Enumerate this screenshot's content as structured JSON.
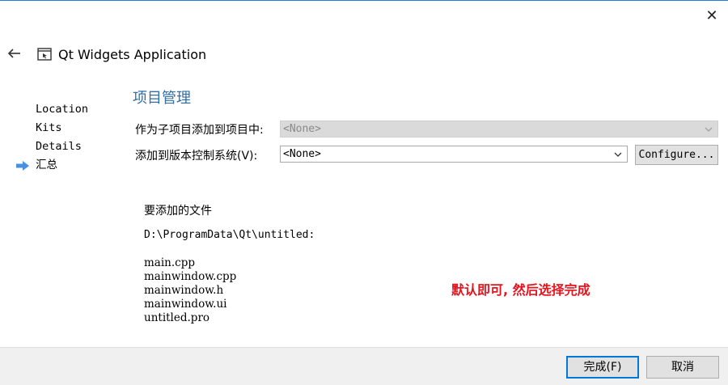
{
  "window": {
    "close_label": "✕",
    "title": "Qt Widgets Application",
    "back_icon": "back-arrow-icon",
    "app_icon": "qt-widgets-app-icon"
  },
  "nav": {
    "items": [
      {
        "label": "Location",
        "active": false
      },
      {
        "label": "Kits",
        "active": false
      },
      {
        "label": "Details",
        "active": false
      },
      {
        "label": "汇总",
        "active": true
      }
    ],
    "active_arrow_color": "#4a8fe0"
  },
  "page": {
    "heading": "项目管理",
    "subproject": {
      "label": "作为子项目添加到项目中:",
      "value": "<None>"
    },
    "vcs": {
      "label": "添加到版本控制系统(V):",
      "value": "<None>",
      "configure_label": "Configure..."
    },
    "files": {
      "heading": "要添加的文件",
      "path": "D:\\ProgramData\\Qt\\untitled:",
      "list": [
        "main.cpp",
        "mainwindow.cpp",
        "mainwindow.h",
        "mainwindow.ui",
        "untitled.pro"
      ]
    }
  },
  "annotation": {
    "text": "默认即可, 然后选择完成",
    "color": "#e5141e"
  },
  "footer": {
    "finish_label": "完成(F)",
    "cancel_label": "取消"
  },
  "colors": {
    "heading": "#2f6eaa",
    "accent": "#0078d7"
  }
}
